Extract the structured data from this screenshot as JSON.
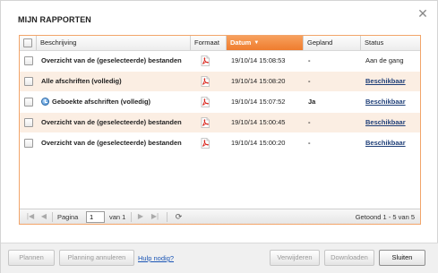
{
  "dialog": {
    "title": "MIJN RAPPORTEN",
    "close_icon": "close-icon"
  },
  "table": {
    "headers": {
      "description": "Beschrijving",
      "format": "Formaat",
      "date": "Datum",
      "scheduled": "Gepland",
      "status": "Status"
    },
    "sorted_column": "date",
    "sort_direction": "descending",
    "rows": [
      {
        "description": "Overzicht van de (geselecteerde) bestanden",
        "format_icon": "pdf-icon",
        "date": "19/10/14 15:08:53",
        "scheduled": "-",
        "status": "Aan de gang",
        "status_is_link": false,
        "scheduled_icon": false
      },
      {
        "description": "Alle afschriften (volledig)",
        "format_icon": "pdf-icon",
        "date": "19/10/14 15:08:20",
        "scheduled": "-",
        "status": "Beschikbaar",
        "status_is_link": true,
        "scheduled_icon": false
      },
      {
        "description": "Geboekte afschriften (volledig)",
        "format_icon": "pdf-icon",
        "date": "19/10/14 15:07:52",
        "scheduled": "Ja",
        "status": "Beschikbaar",
        "status_is_link": true,
        "scheduled_icon": true
      },
      {
        "description": "Overzicht van de (geselecteerde) bestanden",
        "format_icon": "pdf-icon",
        "date": "19/10/14 15:00:45",
        "scheduled": "-",
        "status": "Beschikbaar",
        "status_is_link": true,
        "scheduled_icon": false
      },
      {
        "description": "Overzicht van de (geselecteerde) bestanden",
        "format_icon": "pdf-icon",
        "date": "19/10/14 15:00:20",
        "scheduled": "-",
        "status": "Beschikbaar",
        "status_is_link": true,
        "scheduled_icon": false
      }
    ]
  },
  "pager": {
    "page_label": "Pagina",
    "page_value": "1",
    "of_label": "van 1",
    "summary": "Getoond 1 - 5 van 5"
  },
  "footer": {
    "plan_button": "Plannen",
    "cancel_plan_button": "Planning annuleren",
    "help_link": "Hulp nodig?",
    "delete_button": "Verwijderen",
    "download_button": "Downloaden",
    "close_button": "Sluiten"
  },
  "colors": {
    "accent_orange": "#ef7c2e",
    "row_alt": "#fbeee3",
    "link_blue": "#1f3f78"
  }
}
